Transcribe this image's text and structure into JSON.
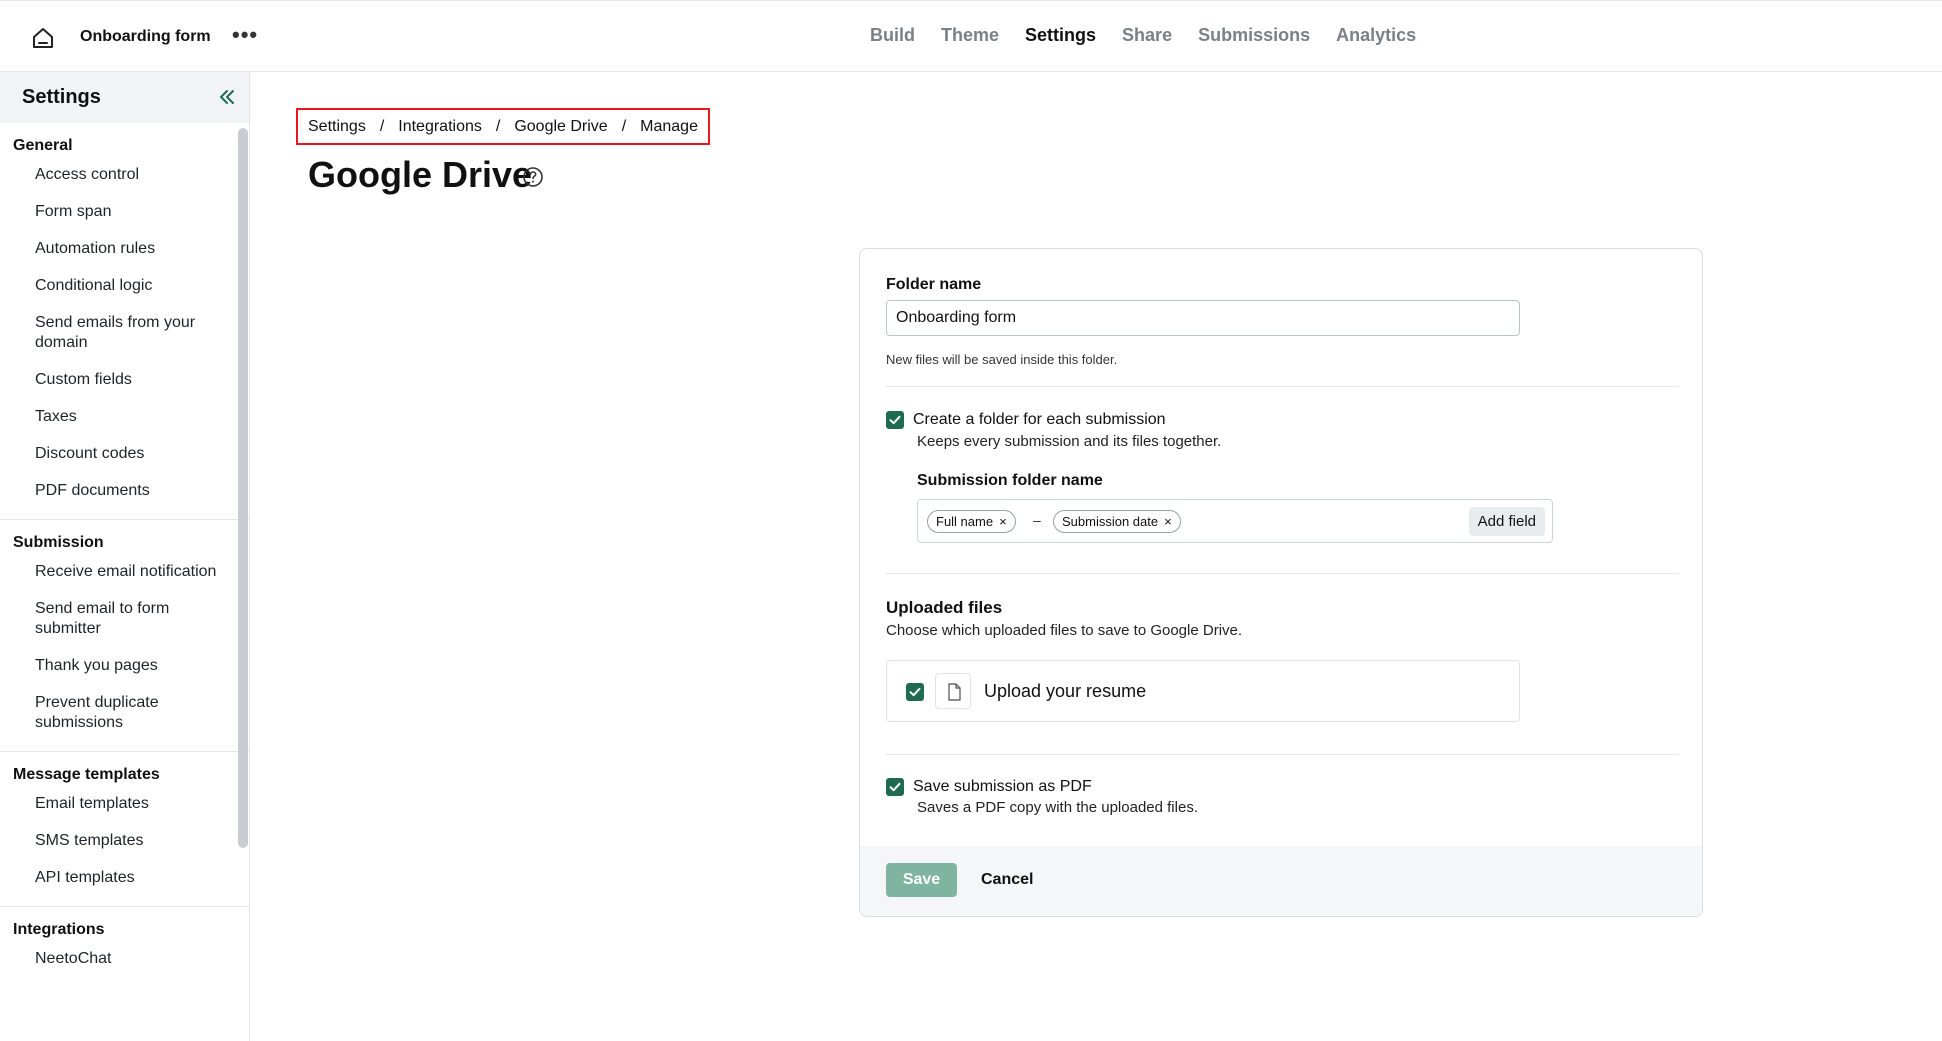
{
  "header": {
    "form_title": "Onboarding form",
    "more_icon": "more-horizontal-icon",
    "home_icon": "home-icon",
    "tabs": [
      {
        "label": "Build",
        "active": false
      },
      {
        "label": "Theme",
        "active": false
      },
      {
        "label": "Settings",
        "active": true
      },
      {
        "label": "Share",
        "active": false
      },
      {
        "label": "Submissions",
        "active": false
      },
      {
        "label": "Analytics",
        "active": false
      }
    ]
  },
  "sidebar": {
    "title": "Settings",
    "collapse_icon": "double-chevron-left-icon",
    "groups": [
      {
        "title": "General",
        "items": [
          "Access control",
          "Form span",
          "Automation rules",
          "Conditional logic",
          "Send emails from your domain",
          "Custom fields",
          "Taxes",
          "Discount codes",
          "PDF documents"
        ]
      },
      {
        "title": "Submission",
        "items": [
          "Receive email notification",
          "Send email to form submitter",
          "Thank you pages",
          "Prevent duplicate submissions"
        ]
      },
      {
        "title": "Message templates",
        "items": [
          "Email templates",
          "SMS templates",
          "API templates"
        ]
      },
      {
        "title": "Integrations",
        "items": [
          "NeetoChat"
        ]
      }
    ]
  },
  "breadcrumb": [
    "Settings",
    "Integrations",
    "Google Drive",
    "Manage"
  ],
  "breadcrumb_separator": "/",
  "page_title": "Google Drive",
  "help_icon": "question-circle-icon",
  "form": {
    "folder_name_label": "Folder name",
    "folder_name_value": "Onboarding form",
    "folder_name_hint": "New files will be saved inside this folder.",
    "create_folder": {
      "checked": true,
      "label": "Create a folder for each submission",
      "description": "Keeps every submission and its files together."
    },
    "submission_folder_label": "Submission folder name",
    "tags": [
      "Full name",
      "Submission date"
    ],
    "tag_remove": "×",
    "tag_separator": "–",
    "add_field_label": "Add field",
    "uploaded_files_title": "Uploaded files",
    "uploaded_files_desc": "Choose which uploaded files to save to Google Drive.",
    "files": [
      {
        "name": "Upload your resume",
        "checked": true,
        "icon": "file-icon"
      }
    ],
    "save_pdf": {
      "checked": true,
      "label": "Save submission as PDF",
      "description": "Saves a PDF copy with the uploaded files."
    },
    "save_label": "Save",
    "cancel_label": "Cancel"
  },
  "colors": {
    "accent": "#1f6b52",
    "save_disabled": "#7fb4a1",
    "highlight_border": "#e5191e"
  }
}
